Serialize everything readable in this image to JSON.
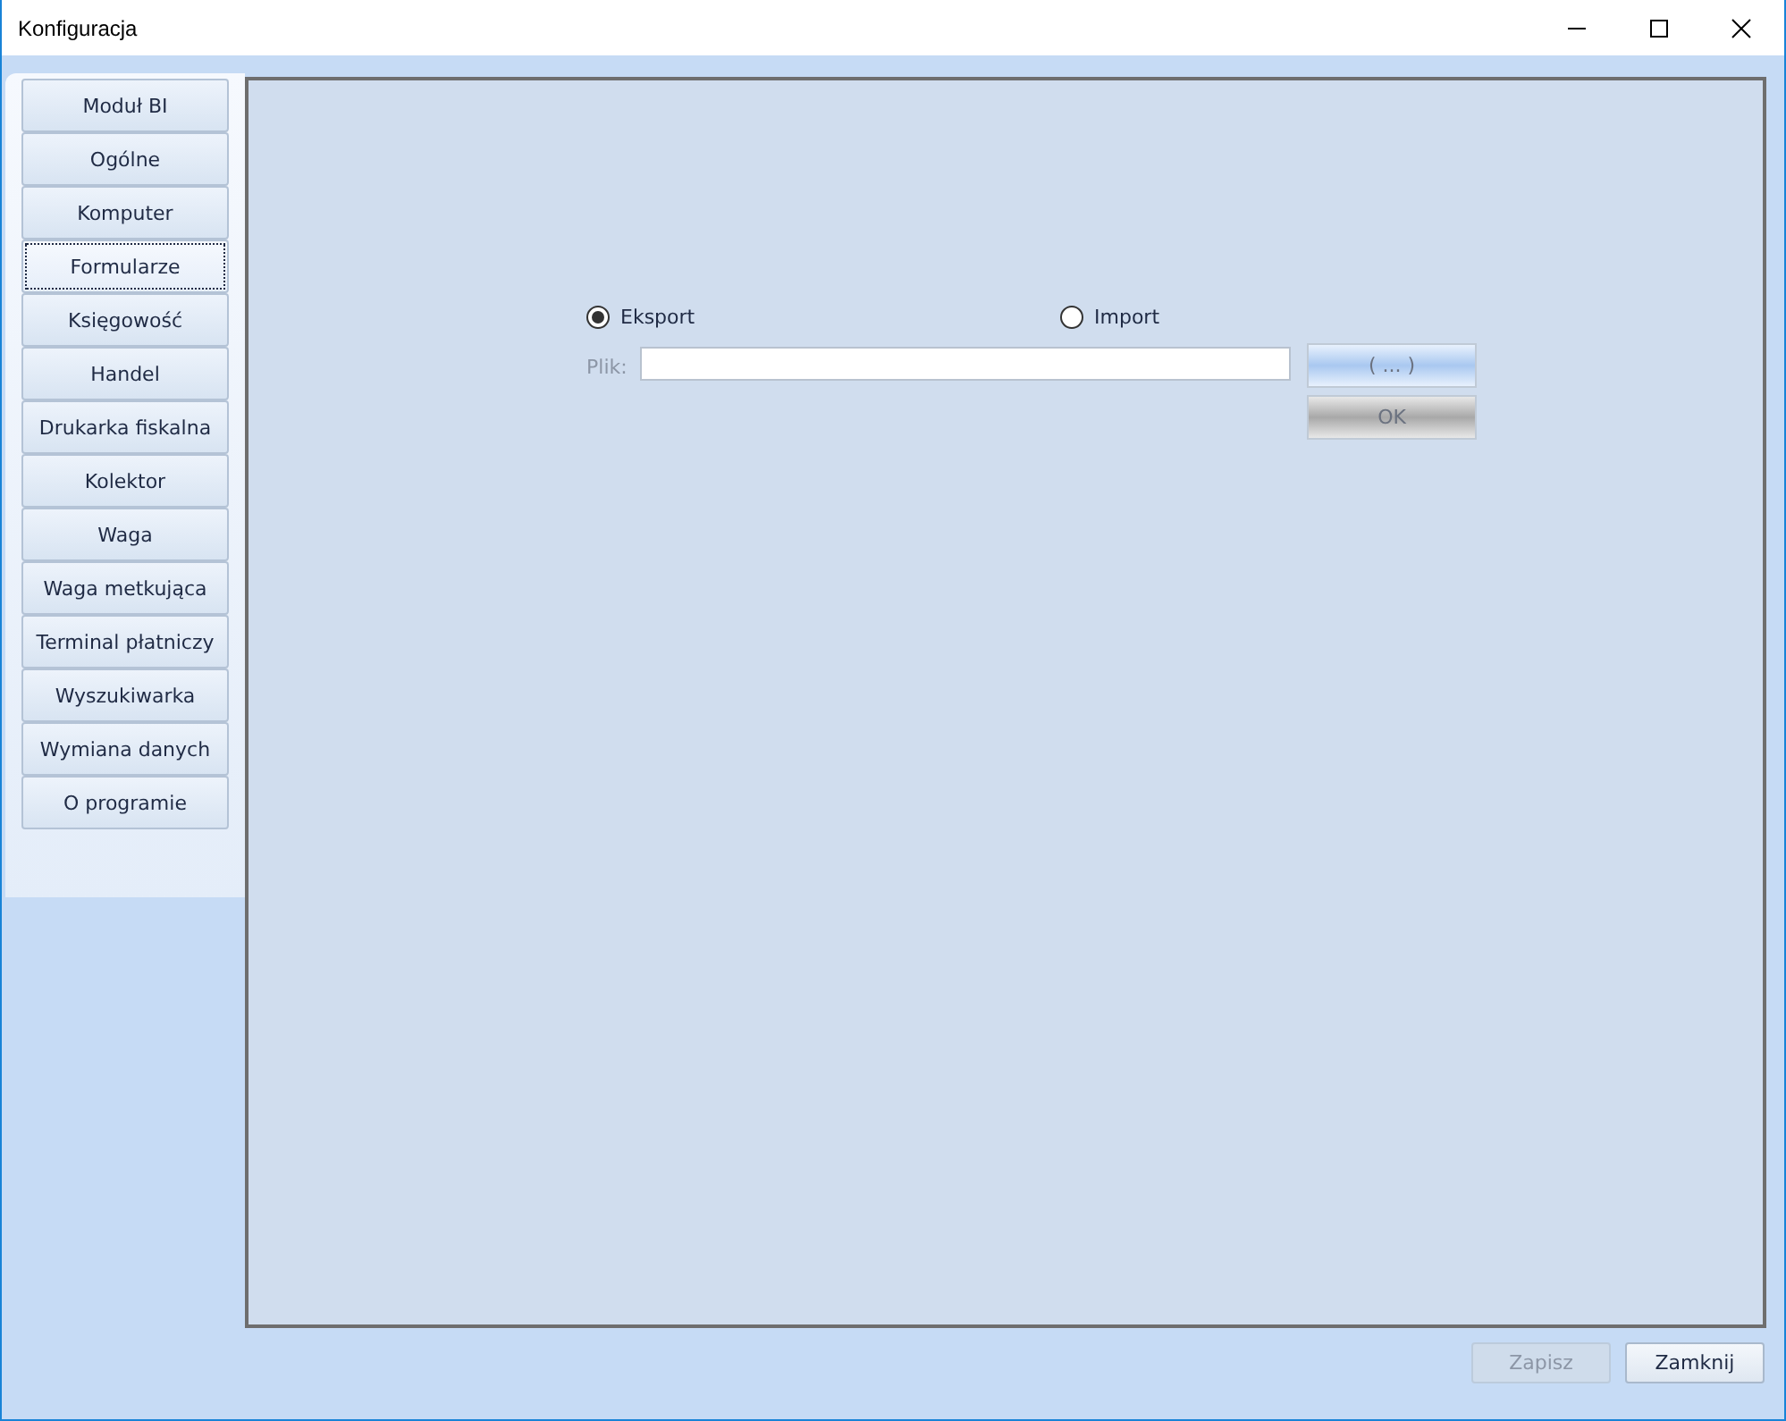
{
  "window": {
    "title": "Konfiguracja"
  },
  "sidebar": {
    "items": [
      {
        "label": "Moduł BI",
        "selected": false
      },
      {
        "label": "Ogólne",
        "selected": false
      },
      {
        "label": "Komputer",
        "selected": false
      },
      {
        "label": "Formularze",
        "selected": true
      },
      {
        "label": "Księgowość",
        "selected": false
      },
      {
        "label": "Handel",
        "selected": false
      },
      {
        "label": "Drukarka fiskalna",
        "selected": false
      },
      {
        "label": "Kolektor",
        "selected": false
      },
      {
        "label": "Waga",
        "selected": false
      },
      {
        "label": "Waga metkująca",
        "selected": false
      },
      {
        "label": "Terminal płatniczy",
        "selected": false
      },
      {
        "label": "Wyszukiwarka",
        "selected": false
      },
      {
        "label": "Wymiana danych",
        "selected": false
      },
      {
        "label": "O programie",
        "selected": false
      }
    ]
  },
  "mode": [
    {
      "label": "Eksport",
      "selected": true
    },
    {
      "label": "Import",
      "selected": false
    }
  ],
  "file": {
    "label": "Plik:",
    "disabled": true
  },
  "browse_button": "( ... )",
  "ok_button": "OK",
  "footer": [
    {
      "label": "Zapisz",
      "disabled": true
    },
    {
      "label": "Zamknij",
      "disabled": false
    }
  ]
}
